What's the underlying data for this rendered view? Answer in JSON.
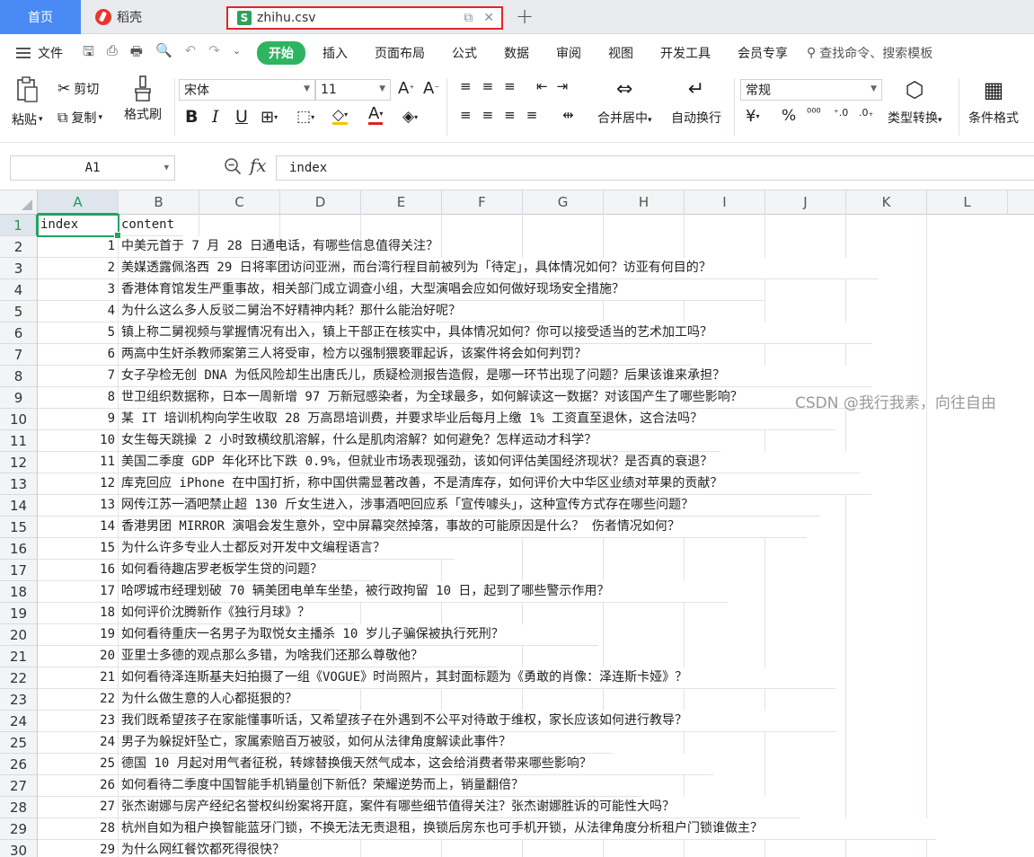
{
  "tabs": {
    "home": "首页",
    "daoke": "稻壳",
    "file": "zhihu.csv",
    "add": "+"
  },
  "menu": {
    "file": "文件",
    "items": [
      "开始",
      "插入",
      "页面布局",
      "公式",
      "数据",
      "审阅",
      "视图",
      "开发工具",
      "会员专享"
    ],
    "search": "查找命令、搜索模板"
  },
  "ribbon": {
    "paste": "粘贴",
    "cut": "剪切",
    "copy": "复制",
    "format_painter": "格式刷",
    "font_name": "宋体",
    "font_size": "11",
    "bold": "B",
    "italic": "I",
    "underline": "U",
    "merge_center": "合并居中",
    "wrap_text": "自动换行",
    "number_format": "常规",
    "type_convert": "类型转换",
    "conditional_format": "条件格式"
  },
  "formula_bar": {
    "cell_ref": "A1",
    "fx": "fx",
    "value": "index"
  },
  "columns": [
    "A",
    "B",
    "C",
    "D",
    "E",
    "F",
    "G",
    "H",
    "I",
    "J",
    "K",
    "L"
  ],
  "rows": [
    {
      "n": "1",
      "a": "index",
      "b": "content"
    },
    {
      "n": "2",
      "a": "1",
      "b": "中美元首于 7 月 28 日通电话，有哪些信息值得关注？"
    },
    {
      "n": "3",
      "a": "2",
      "b": "美媒透露佩洛西 29 日将率团访问亚洲，而台湾行程目前被列为「待定」，具体情况如何？访亚有何目的？"
    },
    {
      "n": "4",
      "a": "3",
      "b": "香港体育馆发生严重事故，相关部门成立调查小组，大型演唱会应如何做好现场安全措施？"
    },
    {
      "n": "5",
      "a": "4",
      "b": "为什么这么多人反驳二舅治不好精神内耗？那什么能治好呢？"
    },
    {
      "n": "6",
      "a": "5",
      "b": "镇上称二舅视频与掌握情况有出入，镇上干部正在核实中，具体情况如何？你可以接受适当的艺术加工吗？"
    },
    {
      "n": "7",
      "a": "6",
      "b": "两高中生奸杀教师案第三人将受审，检方以强制猥亵罪起诉，该案件将会如何判罚？"
    },
    {
      "n": "8",
      "a": "7",
      "b": "女子孕检无创 DNA 为低风险却生出唐氏儿，质疑检测报告造假，是哪一环节出现了问题？后果该谁来承担？"
    },
    {
      "n": "9",
      "a": "8",
      "b": "世卫组织数据称，日本一周新增 97 万新冠感染者，为全球最多，如何解读这一数据？对该国产生了哪些影响？"
    },
    {
      "n": "10",
      "a": "9",
      "b": "某 IT 培训机构向学生收取 28 万高昂培训费，并要求毕业后每月上缴 1% 工资直至退休，这合法吗？"
    },
    {
      "n": "11",
      "a": "10",
      "b": "女生每天跳操 2 小时致横纹肌溶解，什么是肌肉溶解？如何避免？怎样运动才科学？"
    },
    {
      "n": "12",
      "a": "11",
      "b": "美国二季度 GDP 年化环比下跌 0.9%，但就业市场表现强劲，该如何评估美国经济现状？是否真的衰退？"
    },
    {
      "n": "13",
      "a": "12",
      "b": "库克回应 iPhone 在中国打折，称中国供需显著改善，不是清库存，如何评价大中华区业绩对苹果的贡献？"
    },
    {
      "n": "14",
      "a": "13",
      "b": "网传江苏一酒吧禁止超 130 斤女生进入，涉事酒吧回应系「宣传噱头」，这种宣传方式存在哪些问题？"
    },
    {
      "n": "15",
      "a": "14",
      "b": "香港男团 MIRROR 演唱会发生意外，空中屏幕突然掉落，事故的可能原因是什么？ 伤者情况如何？"
    },
    {
      "n": "16",
      "a": "15",
      "b": "为什么许多专业人士都反对开发中文编程语言？"
    },
    {
      "n": "17",
      "a": "16",
      "b": "如何看待趣店罗老板学生贷的问题？"
    },
    {
      "n": "18",
      "a": "17",
      "b": "哈啰城市经理划破 70 辆美团电单车坐垫，被行政拘留 10 日，起到了哪些警示作用？"
    },
    {
      "n": "19",
      "a": "18",
      "b": "如何评价沈腾新作《独行月球》？"
    },
    {
      "n": "20",
      "a": "19",
      "b": "如何看待重庆一名男子为取悦女主播杀 10 岁儿子骗保被执行死刑？"
    },
    {
      "n": "21",
      "a": "20",
      "b": "亚里士多德的观点那么多错，为啥我们还那么尊敬他？"
    },
    {
      "n": "22",
      "a": "21",
      "b": "如何看待泽连斯基夫妇拍摄了一组《VOGUE》时尚照片，其封面标题为《勇敢的肖像：泽连斯卡娅》？"
    },
    {
      "n": "23",
      "a": "22",
      "b": "为什么做生意的人心都挺狠的？"
    },
    {
      "n": "24",
      "a": "23",
      "b": "我们既希望孩子在家能懂事听话，又希望孩子在外遇到不公平对待敢于维权，家长应该如何进行教导？"
    },
    {
      "n": "25",
      "a": "24",
      "b": "男子为躲捉奸坠亡，家属索赔百万被驳，如何从法律角度解读此事件？"
    },
    {
      "n": "26",
      "a": "25",
      "b": "德国 10 月起对用气者征税，转嫁替换俄天然气成本，这会给消费者带来哪些影响？"
    },
    {
      "n": "27",
      "a": "26",
      "b": "如何看待二季度中国智能手机销量创下新低？荣耀逆势而上，销量翻倍？"
    },
    {
      "n": "28",
      "a": "27",
      "b": "张杰谢娜与房产经纪名誉权纠纷案将开庭，案件有哪些细节值得关注？张杰谢娜胜诉的可能性大吗？"
    },
    {
      "n": "29",
      "a": "28",
      "b": "杭州自如为租户换智能蓝牙门锁，不换无法无责退租，换锁后房东也可手机开锁，从法律角度分析租户门锁谁做主？"
    },
    {
      "n": "30",
      "a": "29",
      "b": "为什么网红餐饮都死得很快？"
    }
  ],
  "watermark": "CSDN @我行我素，向往自由",
  "colors": {
    "accent_green": "#22a35e",
    "home_tab": "#4a8af4",
    "highlight_border": "#e0262a"
  }
}
